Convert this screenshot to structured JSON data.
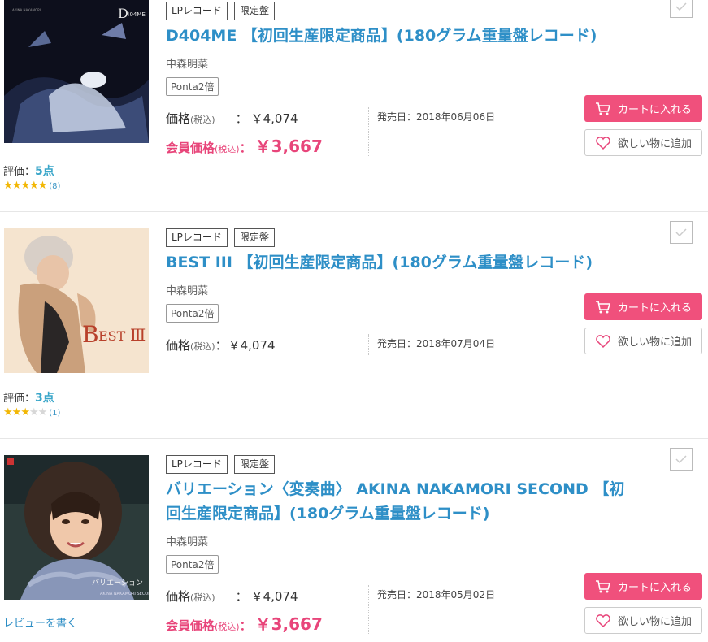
{
  "products": [
    {
      "tags": [
        "LPレコード",
        "限定盤"
      ],
      "title_lines": [
        "D404ME 【初回生産限定商品】(180グラム重量盤レコード)"
      ],
      "artist": "中森明菜",
      "ponta": "Ponta2倍",
      "price_label": "価格",
      "tax_label": "(税込)",
      "price_colon": "：",
      "price": "￥4,074",
      "member_label": "会員価格",
      "member_tax": "(税込)",
      "member_colon": "：",
      "member_price": "￥3,667",
      "release": "発売日：2018年06月06日",
      "cart_label": "カートに入れる",
      "wish_label": "欲しい物に追加",
      "rating_prefix": "評価：",
      "rating_value": "5点",
      "rating_stars": 5,
      "rating_count": "(8)"
    },
    {
      "tags": [
        "LPレコード",
        "限定盤"
      ],
      "title_lines": [
        "BEST III 【初回生産限定商品】(180グラム重量盤レコード)"
      ],
      "artist": "中森明菜",
      "ponta": "Ponta2倍",
      "price_label": "価格",
      "tax_label": "(税込)",
      "price_colon": "：",
      "price": "￥4,074",
      "release": "発売日：2018年07月04日",
      "cart_label": "カートに入れる",
      "wish_label": "欲しい物に追加",
      "rating_prefix": "評価：",
      "rating_value": "3点",
      "rating_stars": 3,
      "rating_count": "(1)"
    },
    {
      "tags": [
        "LPレコード",
        "限定盤"
      ],
      "title_lines": [
        "バリエーション〈変奏曲〉 AKINA NAKAMORI SECOND 【初",
        "回生産限定商品】(180グラム重量盤レコード)"
      ],
      "artist": "中森明菜",
      "ponta": "Ponta2倍",
      "price_label": "価格",
      "tax_label": "(税込)",
      "price_colon": "：",
      "price": "￥4,074",
      "member_label": "会員価格",
      "member_tax": "(税込)",
      "member_colon": "：",
      "member_price": "￥3,667",
      "release": "発売日：2018年05月02日",
      "cart_label": "カートに入れる",
      "wish_label": "欲しい物に追加",
      "review_link": "レビューを書く"
    }
  ],
  "colors": {
    "title": "#2e8fc7",
    "member_price": "#e8457a",
    "cart_button": "#f0507c",
    "star_on": "#f2b705",
    "star_off": "#d7d7d7"
  },
  "icons": {
    "cart": "cart-icon",
    "wish": "heart-icon",
    "checkbox": "check-icon"
  }
}
